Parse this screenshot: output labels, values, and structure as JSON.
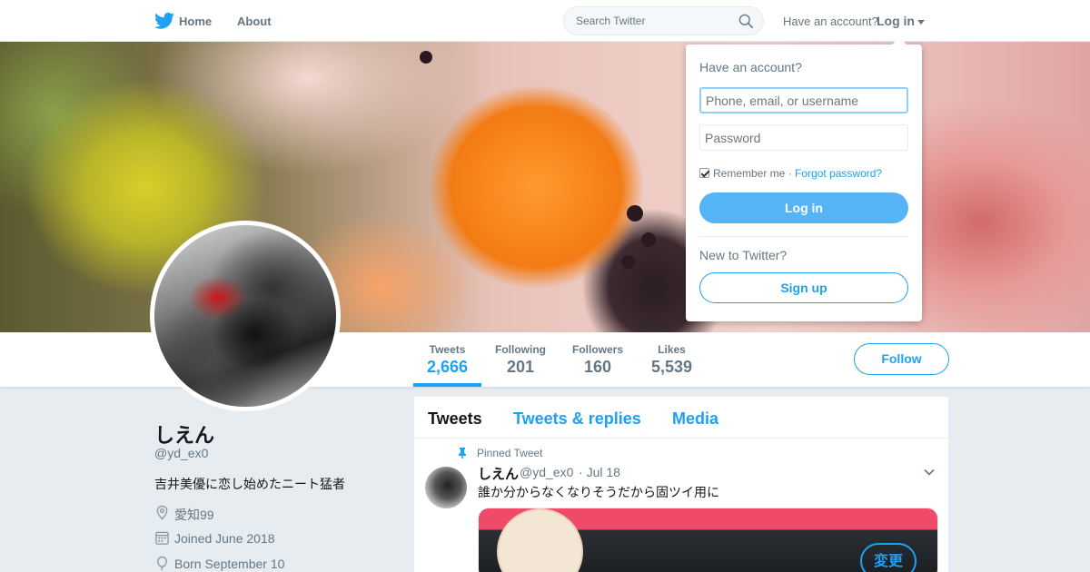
{
  "nav": {
    "logo_icon": "twitter-bird-icon",
    "home_label": "Home",
    "about_label": "About",
    "search_placeholder": "Search Twitter",
    "have_account": "Have an account?",
    "login_label": "Log in"
  },
  "profile": {
    "name": "しえん",
    "handle": "@yd_ex0",
    "bio": "吉井美優に恋し始めたニート猛者",
    "location": "愛知99",
    "joined": "Joined June 2018",
    "born": "Born September 10",
    "follow_label": "Follow",
    "stats": [
      {
        "label": "Tweets",
        "value": "2,666"
      },
      {
        "label": "Following",
        "value": "201"
      },
      {
        "label": "Followers",
        "value": "160"
      },
      {
        "label": "Likes",
        "value": "5,539"
      }
    ]
  },
  "timeline": {
    "tabs": [
      "Tweets",
      "Tweets & replies",
      "Media"
    ],
    "pinned_label": "Pinned Tweet",
    "tweet": {
      "name": "しえん",
      "handle": "@yd_ex0",
      "separator": "·",
      "date": "Jul 18",
      "text": "誰か分からなくなりそうだから固ツイ用に",
      "media_button": "変更"
    }
  },
  "login_dropdown": {
    "title": "Have an account?",
    "username_placeholder": "Phone, email, or username",
    "password_placeholder": "Password",
    "remember_label": "Remember me",
    "separator": "·",
    "forgot_label": "Forgot password?",
    "login_button": "Log in",
    "new_label": "New to Twitter?",
    "signup_button": "Sign up"
  },
  "colors": {
    "accent": "#1da1f2",
    "background": "#e6ecf0",
    "text_secondary": "#657786"
  }
}
